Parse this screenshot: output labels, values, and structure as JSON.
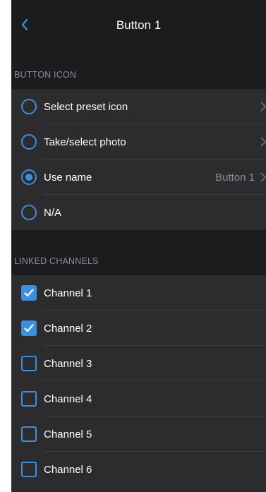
{
  "nav": {
    "title": "Button 1",
    "back_icon": "chevron-left-icon"
  },
  "colors": {
    "accent": "#3b8fe0",
    "background": "#1c1c1e",
    "cell": "#2c2c2e",
    "secondary_text": "#8d8d93"
  },
  "button_icon": {
    "header": "BUTTON ICON",
    "items": [
      {
        "label": "Select preset icon",
        "value": "",
        "selected": false
      },
      {
        "label": "Take/select photo",
        "value": "",
        "selected": false
      },
      {
        "label": "Use name",
        "value": "Button 1",
        "selected": true
      },
      {
        "label": "N/A",
        "value": "",
        "selected": false
      }
    ]
  },
  "linked_channels": {
    "header": "LINKED CHANNELS",
    "items": [
      {
        "label": "Channel 1",
        "checked": true
      },
      {
        "label": "Channel 2",
        "checked": true
      },
      {
        "label": "Channel 3",
        "checked": false
      },
      {
        "label": "Channel 4",
        "checked": false
      },
      {
        "label": "Channel 5",
        "checked": false
      },
      {
        "label": "Channel 6",
        "checked": false
      }
    ]
  }
}
